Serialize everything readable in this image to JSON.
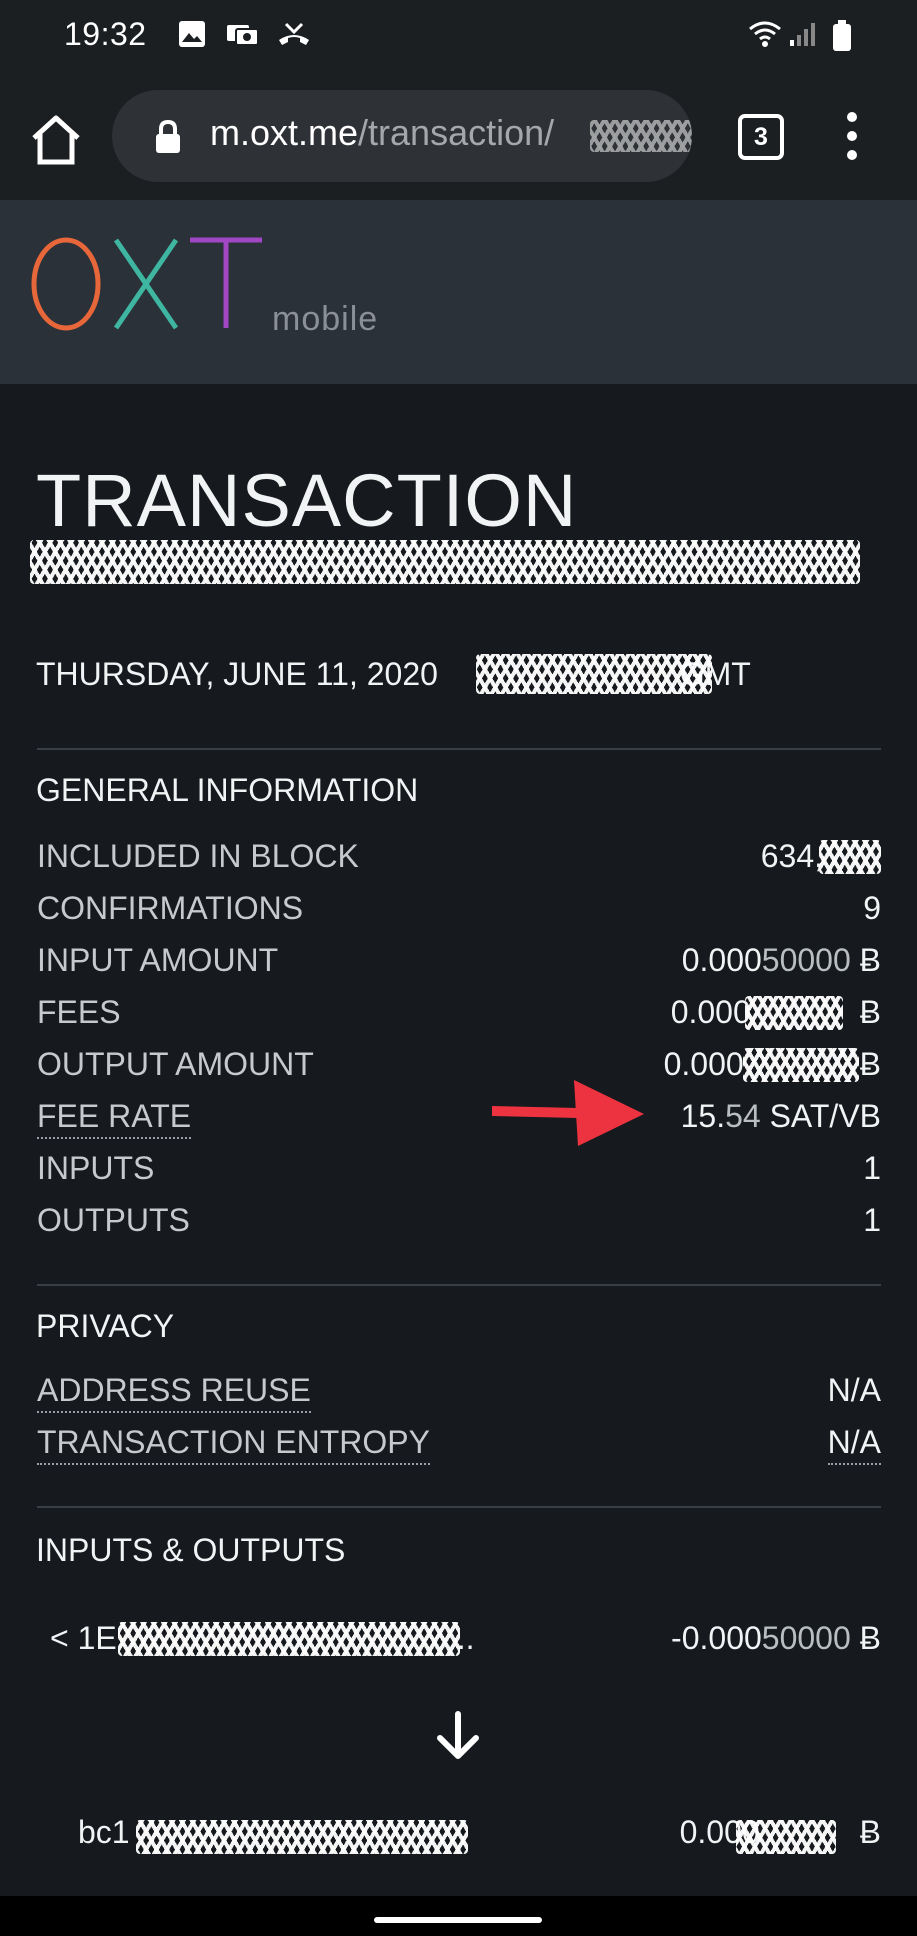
{
  "status_bar": {
    "time": "19:32"
  },
  "browser": {
    "url_host": "m.oxt.me",
    "url_path": "/transaction/",
    "tab_count": "3"
  },
  "site": {
    "logo_text": "OXT",
    "logo_sub": "mobile",
    "logo_colors": {
      "O": "#e8673a",
      "X": "#3fb6a1",
      "T": "#a247c4"
    }
  },
  "transaction": {
    "title": "TRANSACTION",
    "date_prefix": "THURSDAY, JUNE 11, 2020",
    "date_suffix": "GMT"
  },
  "general": {
    "title": "GENERAL INFORMATION",
    "rows": [
      {
        "label": "INCLUDED IN BLOCK",
        "value": "634,"
      },
      {
        "label": "CONFIRMATIONS",
        "value": "9"
      },
      {
        "label": "INPUT AMOUNT",
        "value_main": "0.000",
        "value_dim": "50000",
        "unit": "Ƀ"
      },
      {
        "label": "FEES",
        "value": "0.000",
        "unit": "Ƀ"
      },
      {
        "label": "OUTPUT AMOUNT",
        "value": "0.000",
        "unit": "Ƀ"
      },
      {
        "label": "FEE RATE",
        "value_main": "15.",
        "value_dim": "54",
        "unit": "SAT/VB"
      },
      {
        "label": "INPUTS",
        "value": "1"
      },
      {
        "label": "OUTPUTS",
        "value": "1"
      }
    ]
  },
  "privacy": {
    "title": "PRIVACY",
    "rows": [
      {
        "label": "ADDRESS REUSE",
        "value": "N/A"
      },
      {
        "label": "TRANSACTION ENTROPY",
        "value": "N/A"
      }
    ]
  },
  "io": {
    "title": "INPUTS & OUTPUTS",
    "input_prefix": "< 1E",
    "input_ellipsis": "..",
    "input_amount_main": "-0.000",
    "input_amount_dim": "50000",
    "input_unit": "Ƀ",
    "output_prefix": "bc1",
    "output_amount": "0.000",
    "output_unit": "Ƀ"
  },
  "colors": {
    "accent_arrow": "#ee3340",
    "background": "#16191d",
    "header": "#2b3138"
  }
}
